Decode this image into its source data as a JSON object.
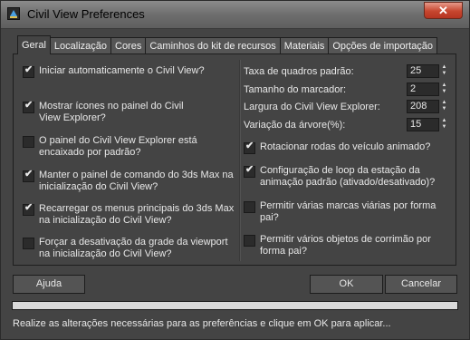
{
  "window": {
    "title": "Civil View Preferences",
    "close_label": "✕"
  },
  "tabs": [
    {
      "label": "Geral",
      "active": true
    },
    {
      "label": "Localização",
      "active": false
    },
    {
      "label": "Cores",
      "active": false
    },
    {
      "label": "Caminhos do kit de recursos",
      "active": false
    },
    {
      "label": "Materiais",
      "active": false
    },
    {
      "label": "Opções de importação",
      "active": false
    }
  ],
  "left_checks": [
    {
      "label": "Iniciar automaticamente o Civil View?",
      "checked": true
    },
    {
      "label": "Mostrar ícones no painel do Civil View Explorer?",
      "checked": true
    },
    {
      "label": "O painel do Civil View Explorer está encaixado por padrão?",
      "checked": false
    },
    {
      "label": "Manter o painel de comando do 3ds Max na inicialização do Civil View?",
      "checked": true
    },
    {
      "label": "Recarregar os menus principais do 3ds Max na inicialização do Civil View?",
      "checked": true
    },
    {
      "label": "Forçar a desativação da grade da viewport na inicialização do Civil View?",
      "checked": false
    }
  ],
  "fields": [
    {
      "label": "Taxa de quadros padrão:",
      "value": "25"
    },
    {
      "label": "Tamanho do marcador:",
      "value": "2"
    },
    {
      "label": "Largura do Civil View Explorer:",
      "value": "208"
    },
    {
      "label": "Variação da árvore(%):",
      "value": "15"
    }
  ],
  "right_checks": [
    {
      "label": "Rotacionar rodas do veículo animado?",
      "checked": true
    },
    {
      "label": "Configuração de loop da estação da animação padrão (ativado/desativado)?",
      "checked": true
    },
    {
      "label": "Permitir várias marcas viárias por forma pai?",
      "checked": false
    },
    {
      "label": "Permitir vários objetos de corrimão por forma pai?",
      "checked": false
    }
  ],
  "buttons": {
    "help": "Ajuda",
    "ok": "OK",
    "cancel": "Cancelar"
  },
  "progress_fraction": 0,
  "status_text": "Realize as alterações necessárias para as preferências e clique em OK para aplicar...",
  "colors": {
    "background": "#444444",
    "close_button": "#c7462f"
  }
}
